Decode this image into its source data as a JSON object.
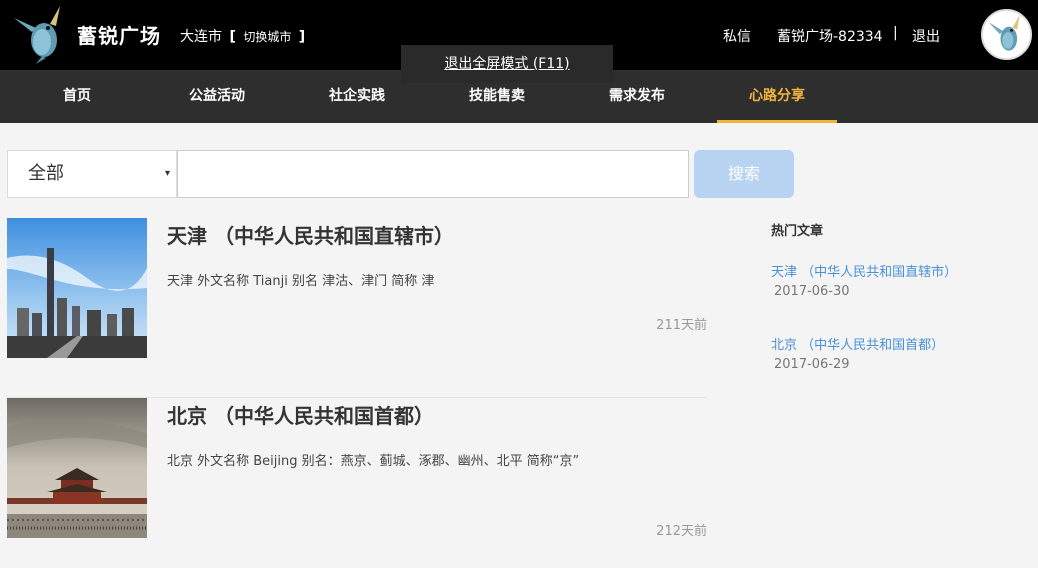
{
  "header": {
    "brand": "蓄锐广场",
    "city": "大连市",
    "switch_city": "切换城市",
    "bracket_open": "[",
    "bracket_close": "]",
    "messages": "私信",
    "username": "蓄锐广场-82334",
    "separator": "|",
    "logout": "退出"
  },
  "fullscreen_popup": {
    "label": "退出全屏模式 (F11)"
  },
  "nav": {
    "items": [
      {
        "label": "首页"
      },
      {
        "label": "公益活动"
      },
      {
        "label": "社企实践"
      },
      {
        "label": "技能售卖"
      },
      {
        "label": "需求发布"
      },
      {
        "label": "心路分享",
        "active": true
      }
    ],
    "accent": "#f0b43c"
  },
  "search": {
    "category": "全部",
    "caret": "▾",
    "query": "",
    "button": "搜索"
  },
  "articles": [
    {
      "title": "天津 （中华人民共和国直辖市）",
      "desc": "天津 外文名称 Tianji 别名 津沽、津门 简称 津",
      "time": "211天前"
    },
    {
      "title": "北京 （中华人民共和国首都）",
      "desc": "北京 外文名称 Beijing 别名：燕京、蓟城、涿郡、幽州、北平 简称“京”",
      "time": "212天前"
    }
  ],
  "sidebar": {
    "title": "热门文章",
    "items": [
      {
        "title": "天津 （中华人民共和国直辖市）",
        "date": "2017-06-30"
      },
      {
        "title": "北京 （中华人民共和国首都）",
        "date": "2017-06-29"
      }
    ]
  },
  "colors": {
    "header_bg": "#000000",
    "nav_bg": "#2e2e2e",
    "link": "#4a90d9",
    "search_button": "#b8d4f2"
  }
}
